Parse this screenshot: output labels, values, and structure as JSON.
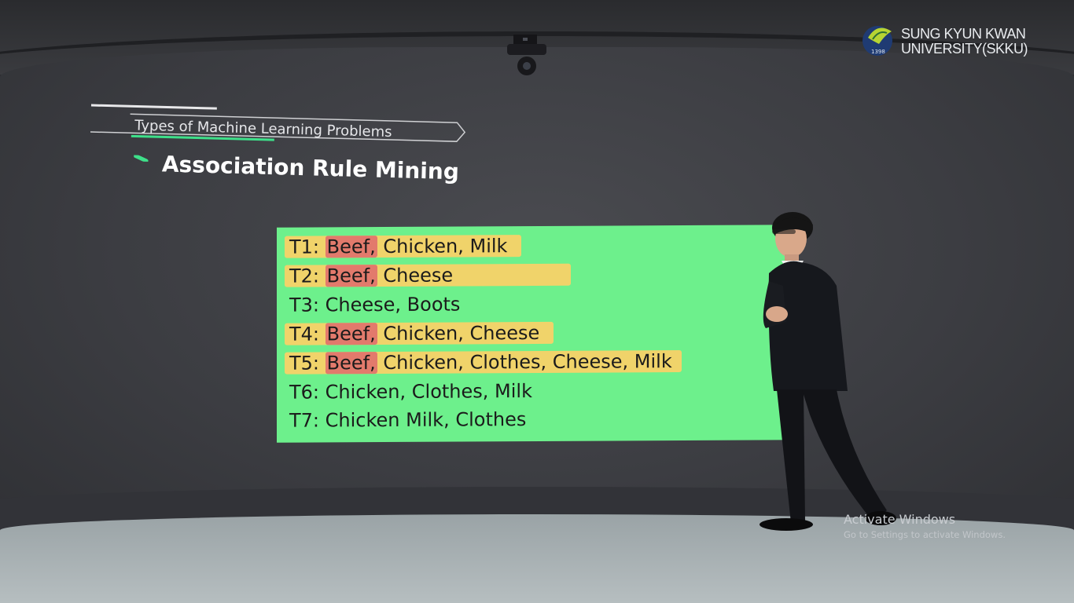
{
  "logo": {
    "line1": "SUNG KYUN KWAN",
    "line2": "UNIVERSITY(SKKU)",
    "year": "1398"
  },
  "header": {
    "subtitle": "Types of Machine Learning Problems",
    "title": "Association Rule Mining"
  },
  "transactions": [
    {
      "id": "T1:",
      "first": "Beef,",
      "rest": "Chicken, Milk"
    },
    {
      "id": "T2:",
      "first": "Beef,",
      "rest": "Cheese"
    },
    {
      "id": "T3:",
      "text": "Cheese, Boots"
    },
    {
      "id": "T4:",
      "first": "Beef,",
      "rest": "Chicken, Cheese"
    },
    {
      "id": "T5:",
      "first": "Beef,",
      "rest": "Chicken, Clothes, Cheese, Milk"
    },
    {
      "id": "T6:",
      "text": "Chicken, Clothes, Milk"
    },
    {
      "id": "T7:",
      "text": "Chicken Milk, Clothes"
    }
  ],
  "watermark": {
    "title": "Activate Windows",
    "subtitle": "Go to Settings to activate Windows."
  },
  "colors": {
    "board": "#6df08c",
    "highlight_yellow": "#f0d36a",
    "highlight_red": "#e27a6c",
    "accent_green": "#3ee08a"
  }
}
